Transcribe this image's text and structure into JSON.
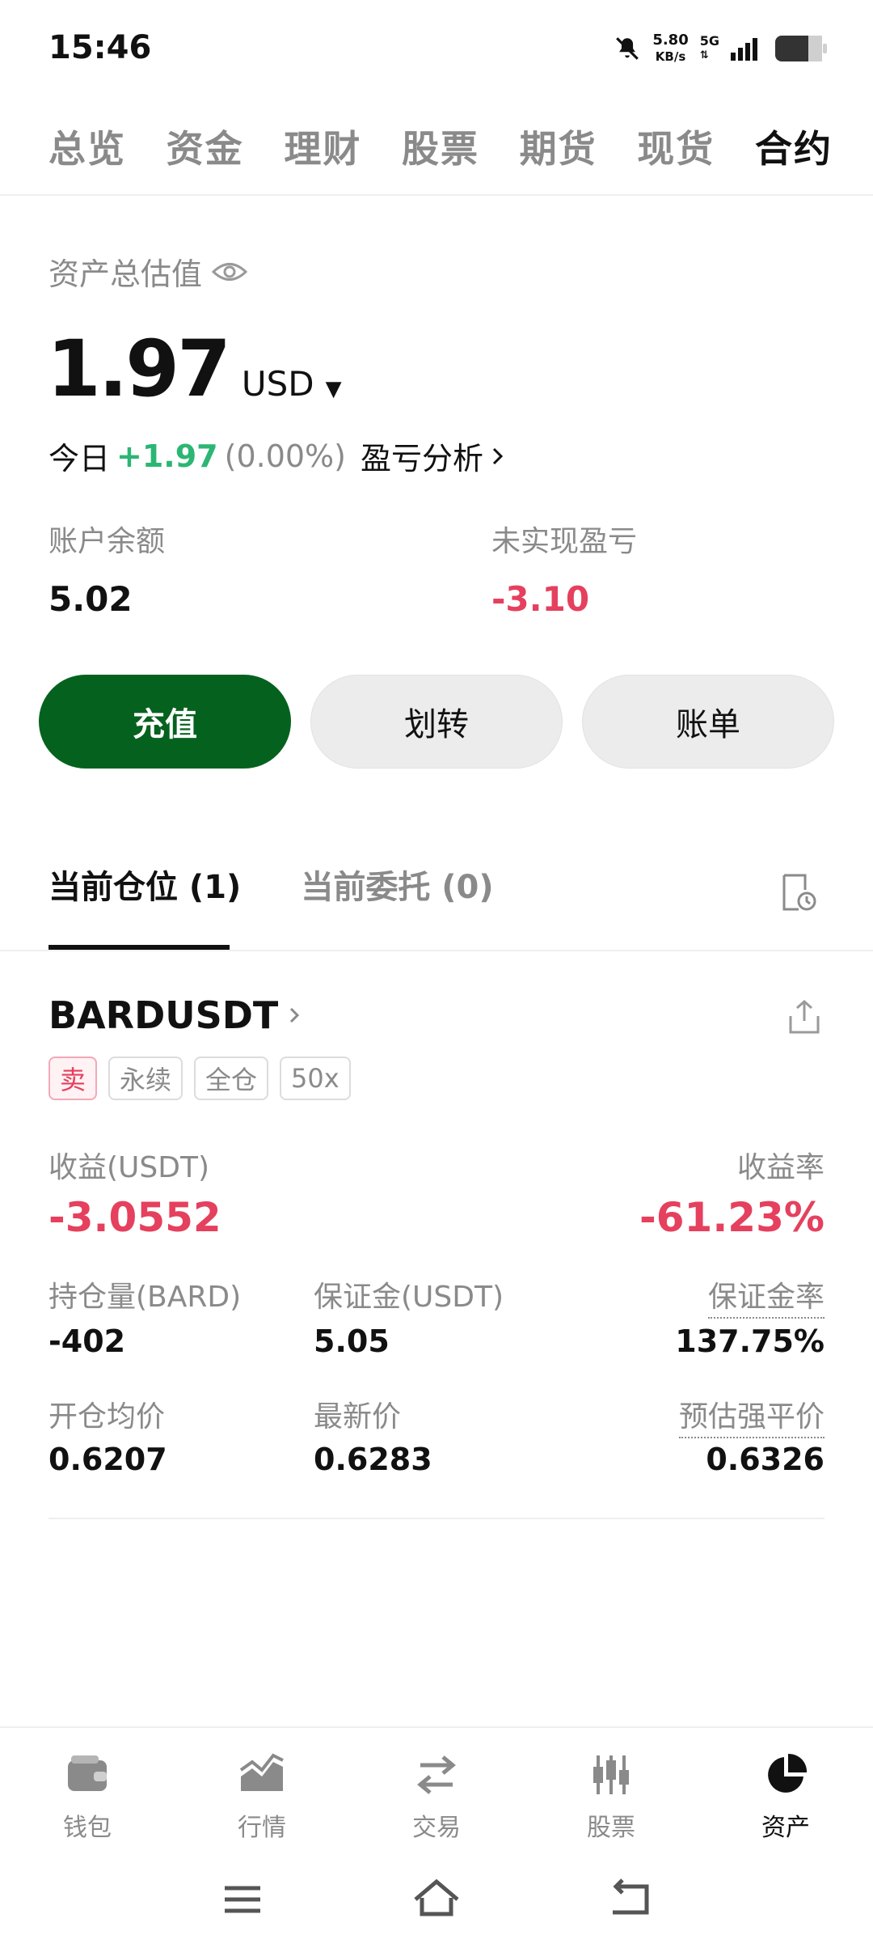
{
  "status_bar": {
    "time": "15:46",
    "speed_value": "5.80",
    "speed_unit": "KB/s",
    "network": "5G",
    "icons": [
      "mute-bell-icon",
      "signal-icon",
      "battery-icon"
    ]
  },
  "top_tabs": [
    {
      "label": "总览",
      "active": false
    },
    {
      "label": "资金",
      "active": false
    },
    {
      "label": "理财",
      "active": false
    },
    {
      "label": "股票",
      "active": false
    },
    {
      "label": "期货",
      "active": false
    },
    {
      "label": "现货",
      "active": false
    },
    {
      "label": "合约",
      "active": true
    }
  ],
  "asset": {
    "label": "资产总估值",
    "value": "1.97",
    "unit": "USD",
    "today_label": "今日",
    "today_change": "+1.97",
    "today_pct": "(0.00%)",
    "analysis_label": "盈亏分析",
    "balance_label": "账户余额",
    "balance_value": "5.02",
    "unrealized_label": "未实现盈亏",
    "unrealized_value": "-3.10"
  },
  "actions": {
    "deposit": "充值",
    "transfer": "划转",
    "bill": "账单"
  },
  "position_tabs": {
    "current_positions": "当前仓位 (1)",
    "current_orders": "当前委托 (0)"
  },
  "position": {
    "symbol": "BARDUSDT",
    "tags": [
      "卖",
      "永续",
      "全仓",
      "50x"
    ],
    "pnl_label": "收益(USDT)",
    "pnl_value": "-3.0552",
    "roi_label": "收益率",
    "roi_value": "-61.23%",
    "size_label": "持仓量(BARD)",
    "size_value": "-402",
    "margin_label": "保证金(USDT)",
    "margin_value": "5.05",
    "margin_ratio_label": "保证金率",
    "margin_ratio_value": "137.75%",
    "entry_label": "开仓均价",
    "entry_value": "0.6207",
    "last_label": "最新价",
    "last_value": "0.6283",
    "liq_label": "预估强平价",
    "liq_value": "0.6326"
  },
  "bottom_nav": [
    {
      "label": "钱包",
      "icon": "wallet-icon",
      "active": false
    },
    {
      "label": "行情",
      "icon": "market-icon",
      "active": false
    },
    {
      "label": "交易",
      "icon": "trade-icon",
      "active": false
    },
    {
      "label": "股票",
      "icon": "stocks-icon",
      "active": false
    },
    {
      "label": "资产",
      "icon": "assets-pie-icon",
      "active": true
    }
  ],
  "colors": {
    "primary_green": "#05621e",
    "positive": "#2bb673",
    "negative": "#e5405e",
    "muted": "#8a8a8a"
  }
}
